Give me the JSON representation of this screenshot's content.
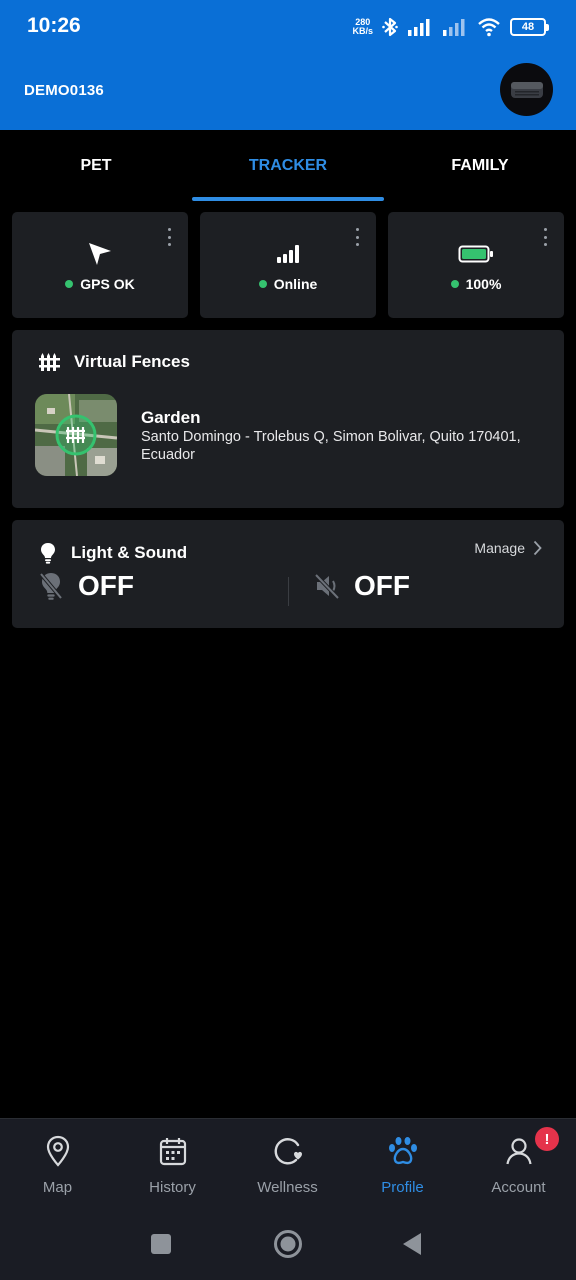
{
  "status_bar": {
    "time": "10:26",
    "net_speed_value": "280",
    "net_speed_unit": "KB/s",
    "battery": "48"
  },
  "header": {
    "device_name": "DEMO0136"
  },
  "tabs": [
    {
      "label": "PET",
      "active": false
    },
    {
      "label": "TRACKER",
      "active": true
    },
    {
      "label": "FAMILY",
      "active": false
    }
  ],
  "status_cards": [
    {
      "icon": "navigation-arrow-icon",
      "label": "GPS OK",
      "dot_color": "#35c26f"
    },
    {
      "icon": "signal-bars-icon",
      "label": "Online",
      "dot_color": "#35c26f"
    },
    {
      "icon": "battery-full-icon",
      "label": "100%",
      "dot_color": "#35c26f"
    }
  ],
  "virtual_fences": {
    "title": "Virtual Fences",
    "fence": {
      "name": "Garden",
      "address": "Santo Domingo - Trolebus Q, Simon Bolivar, Quito 170401, Ecuador"
    }
  },
  "light_sound": {
    "title": "Light & Sound",
    "manage_label": "Manage",
    "light_state": "OFF",
    "sound_state": "OFF"
  },
  "bottom_nav": [
    {
      "label": "Map",
      "icon": "map-pin-icon",
      "active": false
    },
    {
      "label": "History",
      "icon": "calendar-icon",
      "active": false
    },
    {
      "label": "Wellness",
      "icon": "wellness-heart-icon",
      "active": false
    },
    {
      "label": "Profile",
      "icon": "paw-icon",
      "active": true
    },
    {
      "label": "Account",
      "icon": "user-icon",
      "active": false,
      "badge": "!"
    }
  ],
  "colors": {
    "header_bg": "#0a6fd6",
    "accent": "#2f8de4",
    "card_bg": "#1d1f23",
    "status_ok": "#35c26f",
    "badge": "#e5334b"
  }
}
